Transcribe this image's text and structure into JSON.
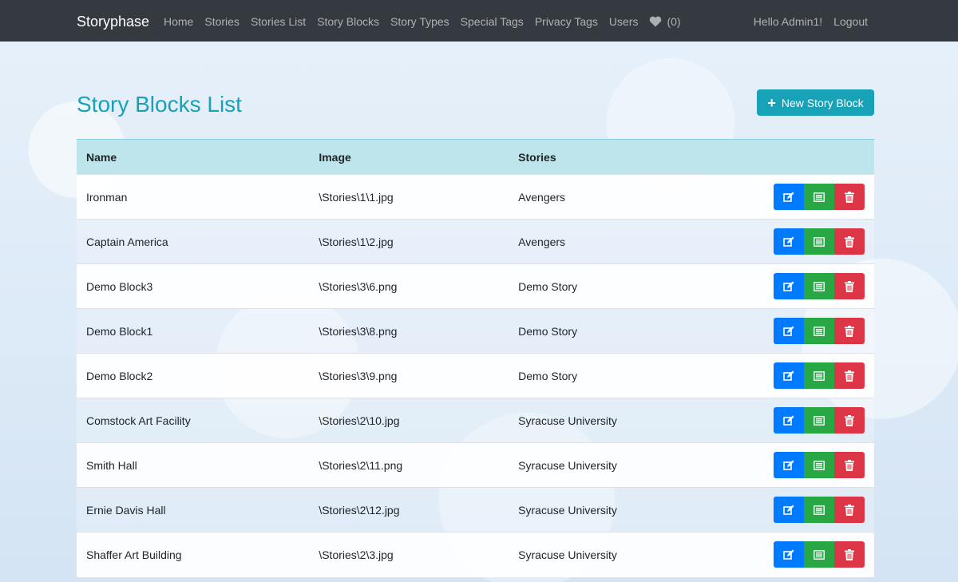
{
  "nav": {
    "brand": "Storyphase",
    "links": [
      "Home",
      "Stories",
      "Stories List",
      "Story Blocks",
      "Story Types",
      "Special Tags",
      "Privacy Tags",
      "Users"
    ],
    "favorites_count": "(0)",
    "greeting": "Hello Admin1!",
    "logout": "Logout"
  },
  "page": {
    "title": "Story Blocks List",
    "new_button_label": "New Story Block"
  },
  "table": {
    "headers": [
      "Name",
      "Image",
      "Stories"
    ],
    "rows": [
      {
        "name": "Ironman",
        "image": "\\Stories\\1\\1.jpg",
        "stories": "Avengers"
      },
      {
        "name": "Captain America",
        "image": "\\Stories\\1\\2.jpg",
        "stories": "Avengers"
      },
      {
        "name": "Demo Block3",
        "image": "\\Stories\\3\\6.png",
        "stories": "Demo Story"
      },
      {
        "name": "Demo Block1",
        "image": "\\Stories\\3\\8.png",
        "stories": "Demo Story"
      },
      {
        "name": "Demo Block2",
        "image": "\\Stories\\3\\9.png",
        "stories": "Demo Story"
      },
      {
        "name": "Comstock Art Facility",
        "image": "\\Stories\\2\\10.jpg",
        "stories": "Syracuse University"
      },
      {
        "name": "Smith Hall",
        "image": "\\Stories\\2\\11.png",
        "stories": "Syracuse University"
      },
      {
        "name": "Ernie Davis Hall",
        "image": "\\Stories\\2\\12.jpg",
        "stories": "Syracuse University"
      },
      {
        "name": "Shaffer Art Building",
        "image": "\\Stories\\2\\3.jpg",
        "stories": "Syracuse University"
      }
    ]
  },
  "colors": {
    "navbar": "#343a40",
    "accent": "#17a2b8",
    "header_row": "#bee5eb",
    "edit": "#007bff",
    "details": "#28a745",
    "delete": "#dc3545"
  },
  "icons": {
    "favorites": "heart-icon",
    "new": "plus-icon",
    "edit": "edit-icon",
    "details": "list-icon",
    "delete": "trash-icon"
  }
}
